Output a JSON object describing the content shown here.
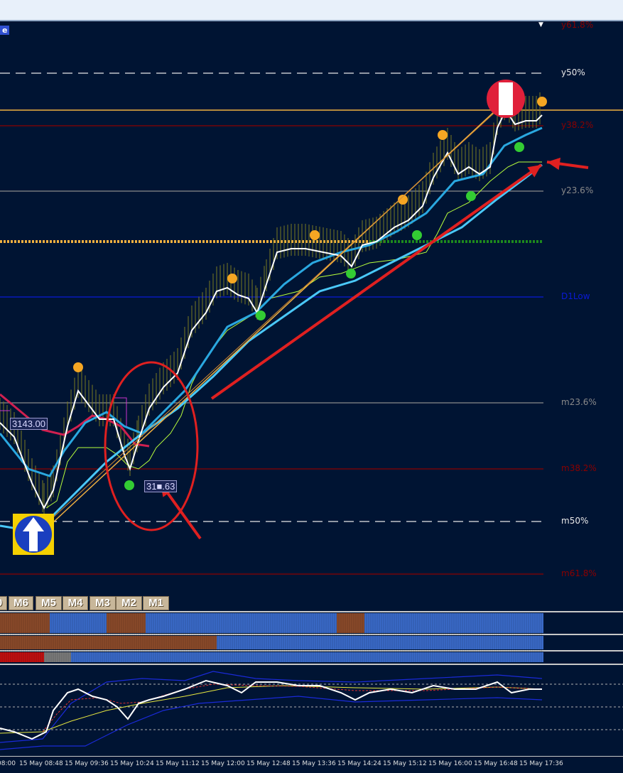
{
  "corner_tag": "e",
  "levels": [
    {
      "key": "y618",
      "label": "y61.8%",
      "color": "#8b0000"
    },
    {
      "key": "y50",
      "label": "y50%",
      "color": "#e8e8e8"
    },
    {
      "key": "y382",
      "label": "y38.2%",
      "color": "#8b0000"
    },
    {
      "key": "y236",
      "label": "y23.6%",
      "color": "#8a8a8a"
    },
    {
      "key": "d1low",
      "label": "D1Low",
      "color": "#0a1ad8"
    },
    {
      "key": "m236",
      "label": "m23.6%",
      "color": "#8a8a8a"
    },
    {
      "key": "m382",
      "label": "m38.2%",
      "color": "#8b0000"
    },
    {
      "key": "m50",
      "label": "m50%",
      "color": "#e8e8e8"
    },
    {
      "key": "m618",
      "label": "m61.8%",
      "color": "#8b0000"
    }
  ],
  "price_boxes": {
    "left": "3143.00",
    "mid": "31■.63"
  },
  "timeframe_tabs": [
    "0",
    "M6",
    "M5",
    "M4",
    "M3",
    "M2",
    "M1"
  ],
  "time_axis": [
    "08:00",
    "15 May 08:48",
    "15 May 09:36",
    "15 May 10:24",
    "15 May 11:12",
    "15 May 12:00",
    "15 May 12:48",
    "15 May 13:36",
    "15 May 14:24",
    "15 May 15:12",
    "15 May 16:00",
    "15 May 16:48",
    "15 May 17:36"
  ],
  "colors": {
    "background": "#001433",
    "price_line": "#ffffff",
    "fast_ma": "#2aa8e0",
    "slow_ma": "#4ac8f8",
    "trend_arrow": "#e02020",
    "swing_high_dot": "#f5a623",
    "swing_low_dot": "#33cc33",
    "orange_level": "#f0b040",
    "buy_arrow_box": "#f5d000",
    "sell_circle": "#e0203a"
  },
  "chart_data": {
    "type": "line",
    "x": [
      "08:00",
      "08:48",
      "09:36",
      "10:24",
      "11:12",
      "12:00",
      "12:48",
      "13:36",
      "14:24",
      "15:12",
      "16:00",
      "16:48",
      "17:36"
    ],
    "series": [
      {
        "values": [
          3146,
          3138,
          3152,
          3139,
          3158,
          3170,
          3176,
          3178,
          3180,
          3185,
          3191,
          3199,
          3202
        ]
      }
    ],
    "price_labels": [
      "3143.00",
      "31■.63"
    ]
  }
}
